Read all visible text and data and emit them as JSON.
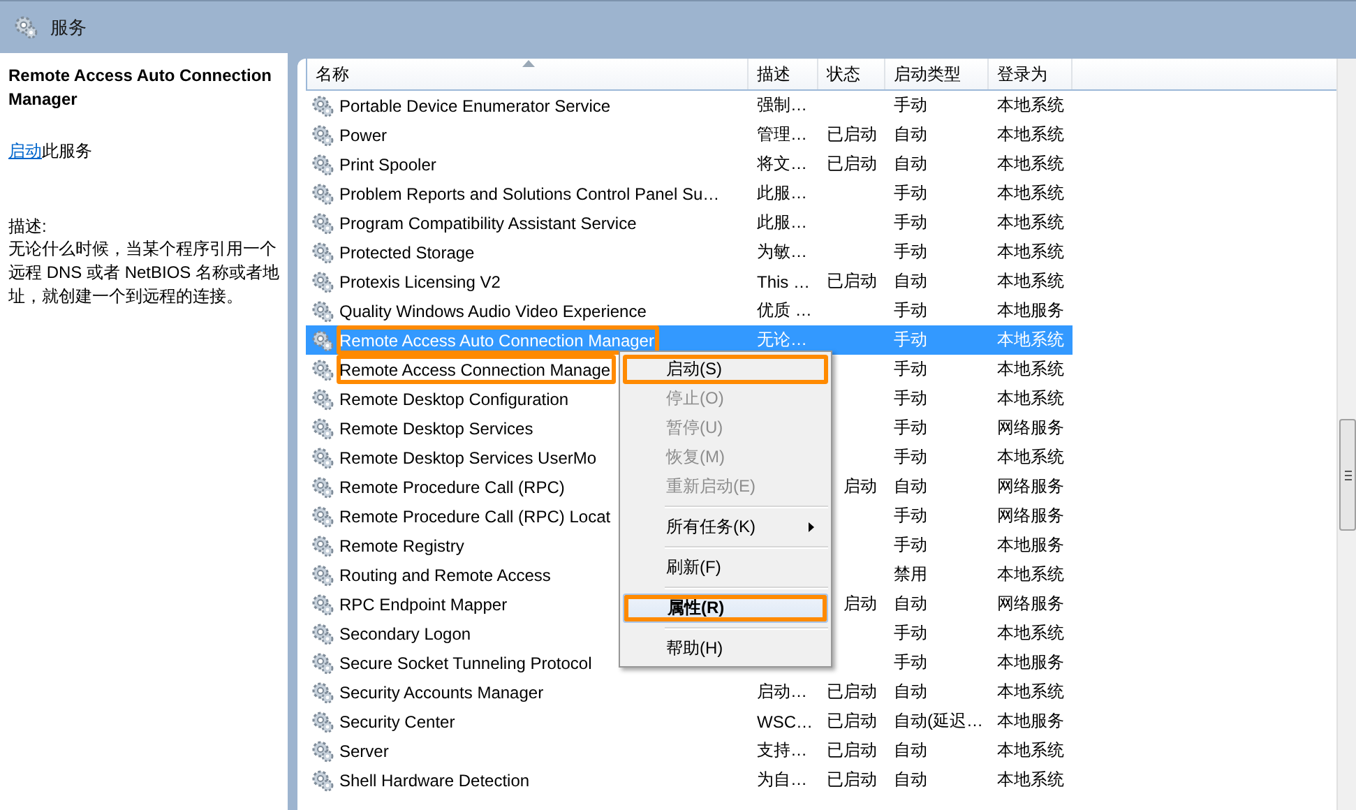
{
  "window": {
    "title": "服务"
  },
  "details": {
    "service_name": "Remote Access Auto Connection Manager",
    "action_link": "启动",
    "action_text": "此服务",
    "description_label": "描述:",
    "description": "无论什么时候，当某个程序引用一个远程 DNS 或者 NetBIOS 名称或者地址，就创建一个到远程的连接。"
  },
  "table": {
    "columns": [
      {
        "label": "名称",
        "sorted": true
      },
      {
        "label": "描述",
        "sorted": false
      },
      {
        "label": "状态",
        "sorted": false
      },
      {
        "label": "启动类型",
        "sorted": false
      },
      {
        "label": "登录为",
        "sorted": false
      }
    ],
    "rows": [
      {
        "name": "Portable Device Enumerator Service",
        "description": "强制…",
        "status": "",
        "startup_type": "手动",
        "log_on_as": "本地系统",
        "selected": false,
        "outlined": false
      },
      {
        "name": "Power",
        "description": "管理…",
        "status": "已启动",
        "startup_type": "自动",
        "log_on_as": "本地系统",
        "selected": false,
        "outlined": false
      },
      {
        "name": "Print Spooler",
        "description": "将文…",
        "status": "已启动",
        "startup_type": "自动",
        "log_on_as": "本地系统",
        "selected": false,
        "outlined": false
      },
      {
        "name": "Problem Reports and Solutions Control Panel Su…",
        "description": "此服…",
        "status": "",
        "startup_type": "手动",
        "log_on_as": "本地系统",
        "selected": false,
        "outlined": false
      },
      {
        "name": "Program Compatibility Assistant Service",
        "description": "此服…",
        "status": "",
        "startup_type": "手动",
        "log_on_as": "本地系统",
        "selected": false,
        "outlined": false
      },
      {
        "name": "Protected Storage",
        "description": "为敏…",
        "status": "",
        "startup_type": "手动",
        "log_on_as": "本地系统",
        "selected": false,
        "outlined": false
      },
      {
        "name": "Protexis Licensing V2",
        "description": "This …",
        "status": "已启动",
        "startup_type": "自动",
        "log_on_as": "本地系统",
        "selected": false,
        "outlined": false
      },
      {
        "name": "Quality Windows Audio Video Experience",
        "description": "优质 …",
        "status": "",
        "startup_type": "手动",
        "log_on_as": "本地服务",
        "selected": false,
        "outlined": false
      },
      {
        "name": "Remote Access Auto Connection Manager",
        "description": "无论…",
        "status": "",
        "startup_type": "手动",
        "log_on_as": "本地系统",
        "selected": true,
        "outlined": true
      },
      {
        "name": "Remote Access Connection Manage",
        "description": "",
        "status": "",
        "startup_type": "手动",
        "log_on_as": "本地系统",
        "selected": false,
        "outlined": true
      },
      {
        "name": "Remote Desktop Configuration",
        "description": "",
        "status": "",
        "startup_type": "手动",
        "log_on_as": "本地系统",
        "selected": false,
        "outlined": false
      },
      {
        "name": "Remote Desktop Services",
        "description": "",
        "status": "",
        "startup_type": "手动",
        "log_on_as": "网络服务",
        "selected": false,
        "outlined": false
      },
      {
        "name": "Remote Desktop Services UserMo",
        "description": "",
        "status": "",
        "startup_type": "手动",
        "log_on_as": "本地系统",
        "selected": false,
        "outlined": false
      },
      {
        "name": "Remote Procedure Call (RPC)",
        "description": "",
        "status": "启动",
        "startup_type": "自动",
        "log_on_as": "网络服务",
        "selected": false,
        "outlined": false
      },
      {
        "name": "Remote Procedure Call (RPC) Locat",
        "description": "",
        "status": "",
        "startup_type": "手动",
        "log_on_as": "网络服务",
        "selected": false,
        "outlined": false
      },
      {
        "name": "Remote Registry",
        "description": "",
        "status": "",
        "startup_type": "手动",
        "log_on_as": "本地服务",
        "selected": false,
        "outlined": false
      },
      {
        "name": "Routing and Remote Access",
        "description": "",
        "status": "",
        "startup_type": "禁用",
        "log_on_as": "本地系统",
        "selected": false,
        "outlined": false
      },
      {
        "name": "RPC Endpoint Mapper",
        "description": "",
        "status": "启动",
        "startup_type": "自动",
        "log_on_as": "网络服务",
        "selected": false,
        "outlined": false
      },
      {
        "name": "Secondary Logon",
        "description": "",
        "status": "",
        "startup_type": "手动",
        "log_on_as": "本地系统",
        "selected": false,
        "outlined": false
      },
      {
        "name": "Secure Socket Tunneling Protocol",
        "description": "",
        "status": "",
        "startup_type": "手动",
        "log_on_as": "本地服务",
        "selected": false,
        "outlined": false
      },
      {
        "name": "Security Accounts Manager",
        "description": "启动…",
        "status": "已启动",
        "startup_type": "自动",
        "log_on_as": "本地系统",
        "selected": false,
        "outlined": false
      },
      {
        "name": "Security Center",
        "description": "WSC…",
        "status": "已启动",
        "startup_type": "自动(延迟…",
        "log_on_as": "本地服务",
        "selected": false,
        "outlined": false
      },
      {
        "name": "Server",
        "description": "支持…",
        "status": "已启动",
        "startup_type": "自动",
        "log_on_as": "本地系统",
        "selected": false,
        "outlined": false
      },
      {
        "name": "Shell Hardware Detection",
        "description": "为自…",
        "status": "已启动",
        "startup_type": "自动",
        "log_on_as": "本地系统",
        "selected": false,
        "outlined": false
      }
    ]
  },
  "context_menu": {
    "items": [
      {
        "kind": "item",
        "label": "启动(S)",
        "disabled": false,
        "default": false,
        "outlined": true,
        "submenu": false
      },
      {
        "kind": "item",
        "label": "停止(O)",
        "disabled": true,
        "default": false,
        "outlined": false,
        "submenu": false
      },
      {
        "kind": "item",
        "label": "暂停(U)",
        "disabled": true,
        "default": false,
        "outlined": false,
        "submenu": false
      },
      {
        "kind": "item",
        "label": "恢复(M)",
        "disabled": true,
        "default": false,
        "outlined": false,
        "submenu": false
      },
      {
        "kind": "item",
        "label": "重新启动(E)",
        "disabled": true,
        "default": false,
        "outlined": false,
        "submenu": false
      },
      {
        "kind": "separator"
      },
      {
        "kind": "item",
        "label": "所有任务(K)",
        "disabled": false,
        "default": false,
        "outlined": false,
        "submenu": true
      },
      {
        "kind": "separator"
      },
      {
        "kind": "item",
        "label": "刷新(F)",
        "disabled": false,
        "default": false,
        "outlined": false,
        "submenu": false
      },
      {
        "kind": "separator"
      },
      {
        "kind": "item",
        "label": "属性(R)",
        "disabled": false,
        "default": true,
        "outlined": true,
        "submenu": false
      },
      {
        "kind": "separator"
      },
      {
        "kind": "item",
        "label": "帮助(H)",
        "disabled": false,
        "default": false,
        "outlined": false,
        "submenu": false
      }
    ]
  }
}
